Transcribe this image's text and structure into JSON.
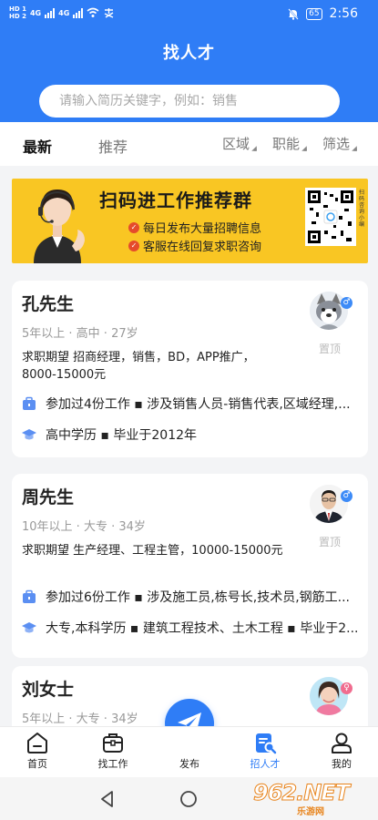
{
  "status_bar": {
    "hd1": "HD 1",
    "hd2": "HD 2",
    "net1": "4G",
    "net2": "4G",
    "battery": "65",
    "time": "2:56"
  },
  "header": {
    "title": "找人才",
    "search_placeholder": "请输入简历关键字，例如：销售"
  },
  "tabs": [
    "最新",
    "推荐"
  ],
  "filters": [
    "区域",
    "职能",
    "筛选"
  ],
  "banner": {
    "title": "扫码进工作推荐群",
    "line1": "每日发布大量招聘信息",
    "line2": "客服在线回复求职咨询",
    "qr_caption": "扫码咨询小编"
  },
  "candidates": [
    {
      "name": "孔先生",
      "meta": "5年以上 · 高中 · 27岁",
      "expect_label": "求职期望",
      "expect": "招商经理，销售，BD，APP推广，8000-15000元",
      "gender": "♂",
      "pin": "置顶",
      "work": "参加过4份工作 ▪ 涉及销售人员-销售代表,区域经理,...",
      "edu": "高中学历 ▪ 毕业于2012年"
    },
    {
      "name": "周先生",
      "meta": "10年以上 · 大专 · 34岁",
      "expect_label": "求职期望",
      "expect": "生产经理、工程主管，10000-15000元",
      "gender": "♂",
      "pin": "置顶",
      "work": "参加过6份工作 ▪ 涉及施工员,栋号长,技术员,钢筋工...",
      "edu": "大专,本科学历 ▪ 建筑工程技术、土木工程 ▪ 毕业于2..."
    },
    {
      "name": "刘女士",
      "meta": "5年以上 · 大专 · 34岁",
      "gender": "♀"
    }
  ],
  "bottom_nav": [
    {
      "label": "首页",
      "icon": "home-icon"
    },
    {
      "label": "找工作",
      "icon": "briefcase-icon"
    },
    {
      "label": "发布",
      "icon": "paper-plane-icon"
    },
    {
      "label": "招人才",
      "icon": "search-resume-icon"
    },
    {
      "label": "我的",
      "icon": "user-icon"
    }
  ],
  "colors": {
    "primary": "#2f7df6",
    "banner": "#f9c623",
    "accent_check": "#e54b2b",
    "male": "#3d8bf7",
    "female": "#f06c8f"
  },
  "watermark": {
    "big": "962.NET",
    "small": "乐游网"
  }
}
